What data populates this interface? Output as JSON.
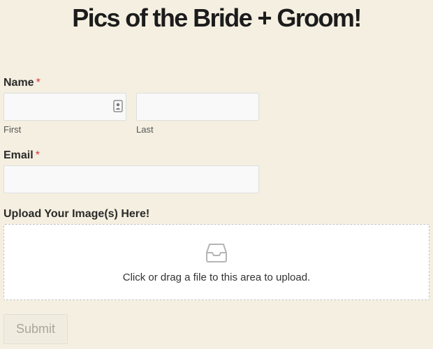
{
  "page": {
    "title": "Pics of the Bride + Groom!"
  },
  "form": {
    "name": {
      "label": "Name",
      "required_mark": "*",
      "first_sublabel": "First",
      "last_sublabel": "Last",
      "first_value": "",
      "last_value": ""
    },
    "email": {
      "label": "Email",
      "required_mark": "*",
      "value": ""
    },
    "upload": {
      "label": "Upload Your Image(s) Here!",
      "prompt": "Click or drag a file to this area to upload.",
      "icon": "inbox-tray-icon"
    },
    "submit_label": "Submit"
  },
  "colors": {
    "background": "#f4efe0",
    "required": "#d63638",
    "input_background": "#f9f9f9",
    "upload_background": "#ffffff",
    "submit_text_disabled": "#aaa69c"
  }
}
